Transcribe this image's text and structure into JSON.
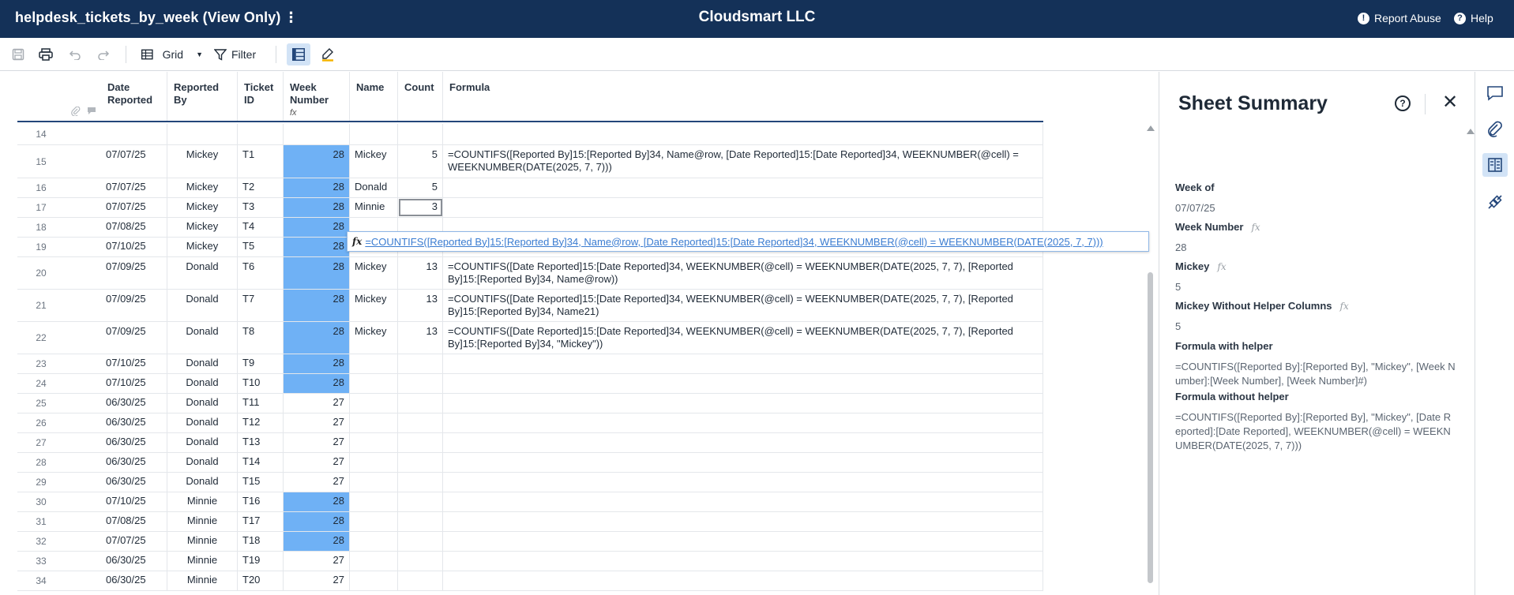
{
  "topbar": {
    "title": "helpdesk_tickets_by_week (View Only)",
    "menu_glyph": "⋮",
    "company": "Cloudsmart LLC",
    "report_abuse": "Report Abuse",
    "help": "Help"
  },
  "toolbar": {
    "view_label": "Grid",
    "filter_label": "Filter"
  },
  "columns": [
    {
      "label": "Date Reported"
    },
    {
      "label": "Reported By"
    },
    {
      "label": "Ticket ID"
    },
    {
      "label": "Week Number",
      "fx": "fx"
    },
    {
      "label": "Name"
    },
    {
      "label": "Count"
    },
    {
      "label": "Formula"
    }
  ],
  "rows": [
    {
      "num": "14",
      "date": "",
      "by": "",
      "id": "",
      "week": "",
      "name": "",
      "count": "",
      "formula": "",
      "hl": false
    },
    {
      "num": "15",
      "date": "07/07/25",
      "by": "Mickey",
      "id": "T1",
      "week": "28",
      "name": "Mickey",
      "count": "5",
      "formula": "=COUNTIFS([Reported By]15:[Reported By]34, Name@row, [Date Reported]15:[Date Reported]34, WEEKNUMBER(@cell) = WEEKNUMBER(DATE(2025, 7, 7)))",
      "hl": true
    },
    {
      "num": "16",
      "date": "07/07/25",
      "by": "Mickey",
      "id": "T2",
      "week": "28",
      "name": "Donald",
      "count": "5",
      "formula": "",
      "hl": true
    },
    {
      "num": "17",
      "date": "07/07/25",
      "by": "Mickey",
      "id": "T3",
      "week": "28",
      "name": "Minnie",
      "count": "3",
      "formula": "",
      "hl": true,
      "sel": true
    },
    {
      "num": "18",
      "date": "07/08/25",
      "by": "Mickey",
      "id": "T4",
      "week": "28",
      "name": "",
      "count": "",
      "formula": "",
      "hl": true
    },
    {
      "num": "19",
      "date": "07/10/25",
      "by": "Mickey",
      "id": "T5",
      "week": "28",
      "name": "",
      "count": "",
      "formula": "",
      "hl": true
    },
    {
      "num": "20",
      "date": "07/09/25",
      "by": "Donald",
      "id": "T6",
      "week": "28",
      "name": "Mickey",
      "count": "13",
      "formula": "=COUNTIFS([Date Reported]15:[Date Reported]34, WEEKNUMBER(@cell) = WEEKNUMBER(DATE(2025, 7, 7), [Reported By]15:[Reported By]34, Name@row))",
      "hl": true
    },
    {
      "num": "21",
      "date": "07/09/25",
      "by": "Donald",
      "id": "T7",
      "week": "28",
      "name": "Mickey",
      "count": "13",
      "formula": "=COUNTIFS([Date Reported]15:[Date Reported]34, WEEKNUMBER(@cell) = WEEKNUMBER(DATE(2025, 7, 7), [Reported By]15:[Reported By]34, Name21)",
      "hl": true
    },
    {
      "num": "22",
      "date": "07/09/25",
      "by": "Donald",
      "id": "T8",
      "week": "28",
      "name": "Mickey",
      "count": "13",
      "formula": "=COUNTIFS([Date Reported]15:[Date Reported]34, WEEKNUMBER(@cell) = WEEKNUMBER(DATE(2025, 7, 7), [Reported By]15:[Reported By]34, \"Mickey\"))",
      "hl": true
    },
    {
      "num": "23",
      "date": "07/10/25",
      "by": "Donald",
      "id": "T9",
      "week": "28",
      "name": "",
      "count": "",
      "formula": "",
      "hl": true
    },
    {
      "num": "24",
      "date": "07/10/25",
      "by": "Donald",
      "id": "T10",
      "week": "28",
      "name": "",
      "count": "",
      "formula": "",
      "hl": true
    },
    {
      "num": "25",
      "date": "06/30/25",
      "by": "Donald",
      "id": "T11",
      "week": "27",
      "name": "",
      "count": "",
      "formula": "",
      "hl": false
    },
    {
      "num": "26",
      "date": "06/30/25",
      "by": "Donald",
      "id": "T12",
      "week": "27",
      "name": "",
      "count": "",
      "formula": "",
      "hl": false
    },
    {
      "num": "27",
      "date": "06/30/25",
      "by": "Donald",
      "id": "T13",
      "week": "27",
      "name": "",
      "count": "",
      "formula": "",
      "hl": false
    },
    {
      "num": "28",
      "date": "06/30/25",
      "by": "Donald",
      "id": "T14",
      "week": "27",
      "name": "",
      "count": "",
      "formula": "",
      "hl": false
    },
    {
      "num": "29",
      "date": "06/30/25",
      "by": "Donald",
      "id": "T15",
      "week": "27",
      "name": "",
      "count": "",
      "formula": "",
      "hl": false
    },
    {
      "num": "30",
      "date": "07/10/25",
      "by": "Minnie",
      "id": "T16",
      "week": "28",
      "name": "",
      "count": "",
      "formula": "",
      "hl": true
    },
    {
      "num": "31",
      "date": "07/08/25",
      "by": "Minnie",
      "id": "T17",
      "week": "28",
      "name": "",
      "count": "",
      "formula": "",
      "hl": true
    },
    {
      "num": "32",
      "date": "07/07/25",
      "by": "Minnie",
      "id": "T18",
      "week": "28",
      "name": "",
      "count": "",
      "formula": "",
      "hl": true
    },
    {
      "num": "33",
      "date": "06/30/25",
      "by": "Minnie",
      "id": "T19",
      "week": "27",
      "name": "",
      "count": "",
      "formula": "",
      "hl": false
    },
    {
      "num": "34",
      "date": "06/30/25",
      "by": "Minnie",
      "id": "T20",
      "week": "27",
      "name": "",
      "count": "",
      "formula": "",
      "hl": false
    }
  ],
  "formula_tooltip": {
    "fx": "fx",
    "text": "=COUNTIFS([Reported By]15:[Reported By]34, Name@row, [Date Reported]15:[Date Reported]34, WEEKNUMBER(@cell) = WEEKNUMBER(DATE(2025, 7, 7)))"
  },
  "summary": {
    "title": "Sheet Summary",
    "help_glyph": "?",
    "close_glyph": "✕",
    "fields": [
      {
        "label": "Week of",
        "value": "07/07/25",
        "fx": ""
      },
      {
        "label": "Week Number",
        "value": "28",
        "fx": "fx"
      },
      {
        "label": "Mickey",
        "value": "5",
        "fx": "fx"
      },
      {
        "label": "Mickey Without Helper Columns",
        "value": "5",
        "fx": "fx"
      },
      {
        "label": "Formula with helper",
        "value": "=COUNTIFS([Reported By]:[Reported By], \"Mickey\", [Week Number]:[Week Number], [Week Number]#)",
        "fx": ""
      },
      {
        "label": "Formula without helper",
        "value": "=COUNTIFS([Reported By]:[Reported By], \"Mickey\", [Date Reported]:[Date Reported], WEEKNUMBER(@cell) = WEEKNUMBER(DATE(2025, 7, 7)))",
        "fx": ""
      }
    ]
  },
  "colors": {
    "topbar": "#143158",
    "highlight": "#6fb1f5",
    "header_border": "#23467a",
    "link": "#3a7cd1"
  }
}
